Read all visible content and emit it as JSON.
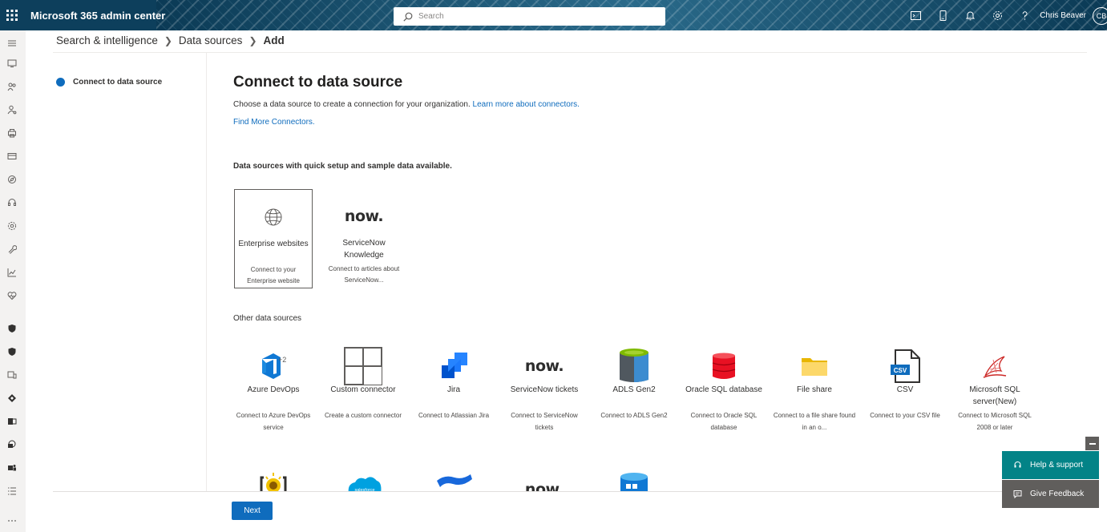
{
  "header": {
    "app_title": "Microsoft 365 admin center",
    "search_placeholder": "Search",
    "user_name": "Chris Beaver",
    "user_initials": "CB",
    "bg_color": "#0d3f5c"
  },
  "breadcrumb": {
    "items": [
      "Search & intelligence",
      "Data sources"
    ],
    "current": "Add"
  },
  "wizard": {
    "steps": [
      {
        "label": "Connect to data source",
        "active": true
      }
    ]
  },
  "main": {
    "title": "Connect to data source",
    "intro_text": "Choose a data source to create a connection for your organization.",
    "learn_more_link": "Learn more about connectors.",
    "find_more_link": "Find More Connectors.",
    "quick_section_title": "Data sources with quick setup and sample data available.",
    "quick_sources": [
      {
        "name": "Enterprise websites",
        "desc": "Connect to your Enterprise website",
        "icon": "globe-icon",
        "selected": true
      },
      {
        "name": "ServiceNow Knowledge",
        "desc": "Connect to articles about ServiceNow...",
        "icon": "servicenow-logo",
        "logo_text": "now."
      }
    ],
    "other_section_title": "Other data sources",
    "other_sources": [
      {
        "name": "Azure DevOps",
        "desc": "Connect to Azure DevOps service",
        "icon": "azure-devops-icon",
        "badge": "+2"
      },
      {
        "name": "Custom connector",
        "desc": "Create a custom connector",
        "icon": "custom-connector-icon"
      },
      {
        "name": "Jira",
        "desc": "Connect to Atlassian Jira",
        "icon": "jira-icon"
      },
      {
        "name": "ServiceNow tickets",
        "desc": "Connect to ServiceNow tickets",
        "icon": "servicenow-logo",
        "logo_text": "now."
      },
      {
        "name": "ADLS Gen2",
        "desc": "Connect to ADLS Gen2",
        "icon": "adls-icon"
      },
      {
        "name": "Oracle SQL database",
        "desc": "Connect to Oracle SQL database",
        "icon": "oracle-db-icon"
      },
      {
        "name": "File share",
        "desc": "Connect to a file share found in an o...",
        "icon": "folder-icon"
      },
      {
        "name": "CSV",
        "desc": "Connect to your CSV file",
        "icon": "csv-file-icon",
        "icon_text": "CSV"
      },
      {
        "name": "Microsoft SQL server(New)",
        "desc": "Connect to Microsoft SQL 2008 or later",
        "icon": "sql-server-icon"
      }
    ],
    "partial_row_icons": [
      "sun-bracket-icon",
      "salesforce-icon",
      "confluence-icon",
      "servicenow-logo",
      "azure-storage-icon"
    ],
    "partial_logo_text": "now.",
    "salesforce_text": "salesforce"
  },
  "footer": {
    "next_label": "Next"
  },
  "support": {
    "help_label": "Help & support",
    "feedback_label": "Give Feedback",
    "help_color": "#038387",
    "feedback_color": "#605e5c"
  },
  "colors": {
    "accent": "#0f6cbd"
  }
}
